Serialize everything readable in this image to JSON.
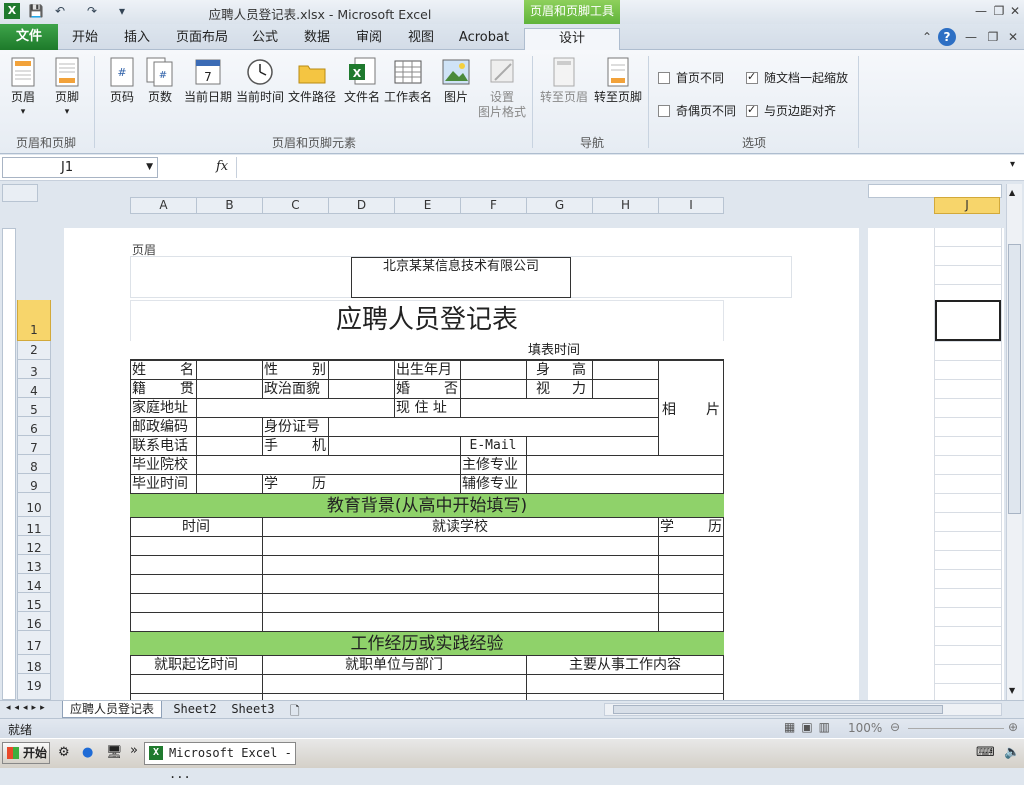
{
  "window": {
    "title": "应聘人员登记表.xlsx - Microsoft Excel",
    "context_tab_title": "页眉和页脚工具"
  },
  "tabs": {
    "file": "文件",
    "items": [
      "开始",
      "插入",
      "页面布局",
      "公式",
      "数据",
      "审阅",
      "视图",
      "Acrobat"
    ],
    "design": "设计"
  },
  "ribbon": {
    "hf_group": {
      "label": "页眉和页脚",
      "header": "页眉",
      "footer": "页脚"
    },
    "elements_group": {
      "label": "页眉和页脚元素",
      "items": [
        "页码",
        "页数",
        "当前日期",
        "当前时间",
        "文件路径",
        "文件名",
        "工作表名",
        "图片"
      ],
      "format_picture": [
        "设置",
        "图片格式"
      ]
    },
    "nav_group": {
      "label": "导航",
      "goto_header": "转至页眉",
      "goto_footer": "转至页脚"
    },
    "options_group": {
      "label": "选项",
      "first_page": "首页不同",
      "odd_even": "奇偶页不同",
      "scale_with_doc": "随文档一起缩放",
      "align_margins": "与页边距对齐"
    }
  },
  "formula_bar": {
    "name_box": "J1",
    "fx": "fx",
    "formula": ""
  },
  "columns": [
    "A",
    "B",
    "C",
    "D",
    "E",
    "F",
    "G",
    "H",
    "I",
    "J"
  ],
  "rows": [
    "1",
    "2",
    "3",
    "4",
    "5",
    "6",
    "7",
    "8",
    "9",
    "10",
    "11",
    "12",
    "13",
    "14",
    "15",
    "16",
    "17",
    "18",
    "19"
  ],
  "sheet": {
    "header_label": "页眉",
    "company": "北京某某信息技术有限公司",
    "form_title": "应聘人员登记表",
    "fill_time": "填表时间",
    "fields": {
      "name": "姓 名",
      "gender": "性 别",
      "birth": "出生年月",
      "height": "身 高",
      "native": "籍 贯",
      "politics": "政治面貌",
      "marriage": "婚 否",
      "vision": "视 力",
      "home_addr": "家庭地址",
      "current_addr": "现 住 址",
      "photo": "相 片",
      "postcode": "邮政编码",
      "id_no": "身份证号",
      "phone": "联系电话",
      "mobile": "手 机",
      "email": "E-Mail",
      "school": "毕业院校",
      "major": "主修专业",
      "grad_time": "毕业时间",
      "degree": "学 历",
      "minor": "辅修专业"
    },
    "education_title": "教育背景(从高中开始填写)",
    "edu_cols": [
      "时间",
      "就读学校",
      "学 历"
    ],
    "work_title": "工作经历或实践经验",
    "work_cols": [
      "就职起讫时间",
      "就职单位与部门",
      "主要从事工作内容"
    ]
  },
  "sheet_tabs": [
    "应聘人员登记表",
    "Sheet2",
    "Sheet3"
  ],
  "status": {
    "ready": "就绪",
    "zoom": "100%"
  },
  "taskbar": {
    "start": "开始",
    "task": "Microsoft Excel - ..."
  },
  "colors": {
    "green_band": "#8fd26a",
    "file_tab": "#2a8a36",
    "context_tab": "#6bbd45"
  }
}
